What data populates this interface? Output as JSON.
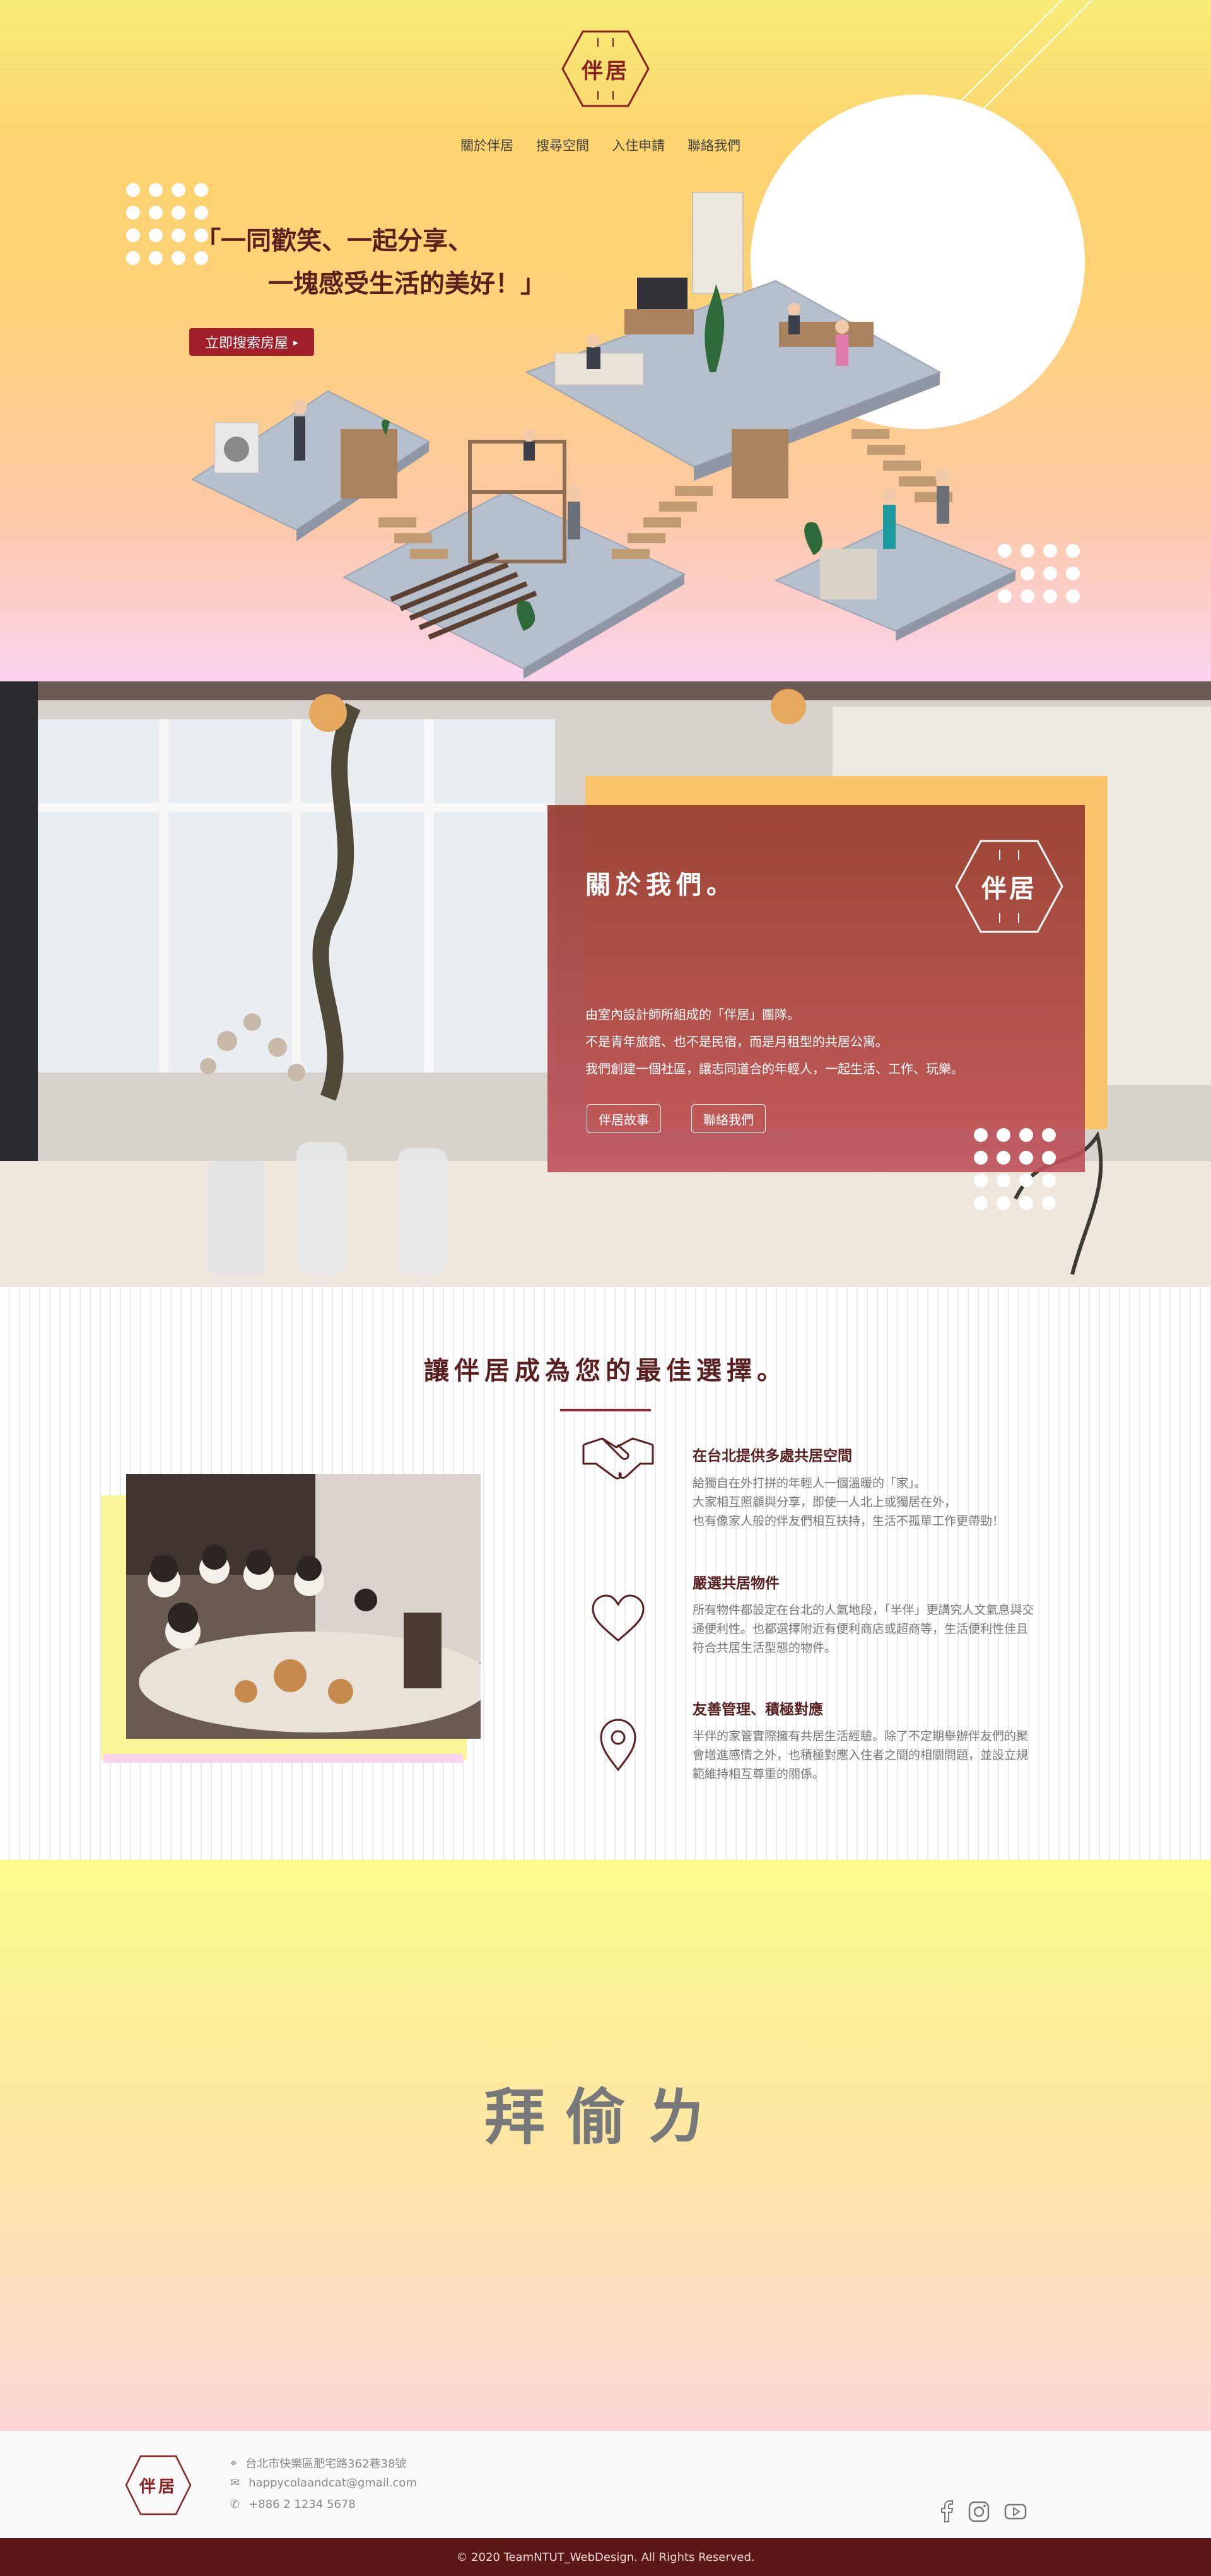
{
  "brand": {
    "name": "伴居",
    "accent": "#a01f2a",
    "dark_red": "#5a1f1f"
  },
  "nav": {
    "items": [
      "關於伴居",
      "搜尋空間",
      "入住申請",
      "聯絡我們"
    ]
  },
  "hero": {
    "slogan_line1": "「一同歡笑、一起分享、",
    "slogan_line2": "一塊感受生活的美好！」",
    "cta_label": "立即搜索房屋",
    "cta_icon": "chevron-right-icon"
  },
  "about": {
    "title": "關於我們。",
    "p1": "由室內設計師所組成的「伴居」團隊。",
    "p2": "不是青年旅館、也不是民宿，而是月租型的共居公寓。",
    "p3": "我們創建一個社區，讓志同道合的年輕人，一起生活、工作、玩樂。",
    "btn_story": "伴居故事",
    "btn_contact": "聯絡我們"
  },
  "choose": {
    "title": "讓伴居成為您的最佳選擇。",
    "features": [
      {
        "icon": "handshake-icon",
        "title": "在台北提供多處共居空間",
        "lines": [
          "給獨自在外打拼的年輕人一個溫暖的「家」。",
          "大家相互照顧與分享，即使一人北上或獨居在外，",
          "也有像家人般的伴友們相互扶持，生活不孤單工作更帶勁！"
        ]
      },
      {
        "icon": "heart-icon",
        "title": "嚴選共居物件",
        "lines": [
          "所有物件都設定在台北的人氣地段，「半伴」更講究人文氣息與交",
          "通便利性。也都選擇附近有便利商店或超商等，生活便利性佳且",
          "符合共居生活型態的物件。"
        ]
      },
      {
        "icon": "location-pin-icon",
        "title": "友善管理、積極對應",
        "lines": [
          "半伴的家管實際擁有共居生活經驗。除了不定期舉辦伴友們的聚",
          "會增進感情之外，也積極對應入住者之間的相關問題，並設立規",
          "範維持相互尊重的關係。"
        ]
      }
    ]
  },
  "bye": {
    "text": "拜偷ㄌ"
  },
  "footer": {
    "address": "台北市快樂區肥宅路362巷38號",
    "email": "happycolaandcat@gmail.com",
    "phone": "+886 2 1234 5678",
    "social": [
      "facebook-icon",
      "instagram-icon",
      "youtube-icon"
    ],
    "copyright": "© 2020 TeamNTUT_WebDesign. All Rights Reserved."
  }
}
